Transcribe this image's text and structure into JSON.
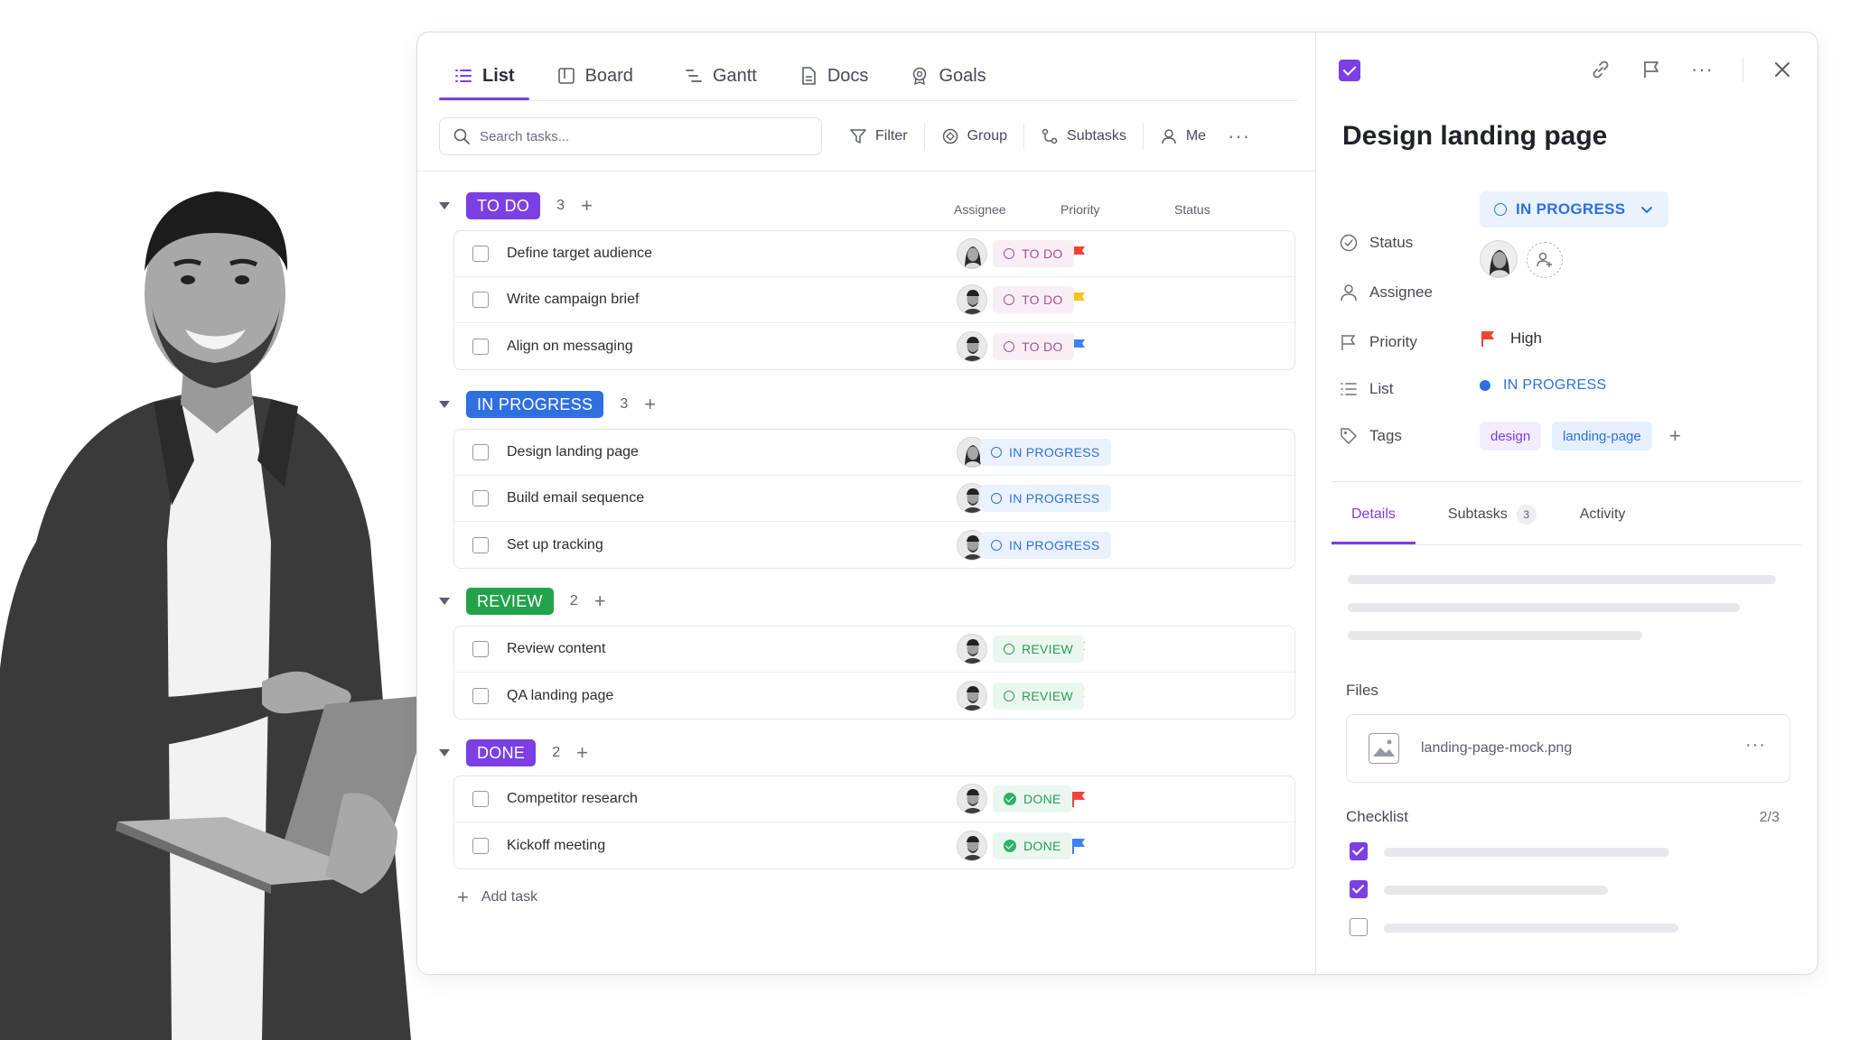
{
  "colors": {
    "accent": "#7b3fe4",
    "todo": "#7b3fe4",
    "in_progress": "#2f6fe0",
    "review": "#22a34a",
    "done": "#7b3fe4",
    "flag_red": "#f04438",
    "flag_yellow": "#f5c518",
    "flag_blue": "#3b82f6"
  },
  "tabs": [
    {
      "label": "List",
      "icon": "list-icon",
      "active": true
    },
    {
      "label": "Board",
      "icon": "board-icon"
    },
    {
      "label": "Gantt",
      "icon": "gantt-icon"
    },
    {
      "label": "Docs",
      "icon": "docs-icon"
    },
    {
      "label": "Goals",
      "icon": "goals-icon"
    }
  ],
  "toolbar": {
    "search_placeholder": "Search tasks...",
    "filter": "Filter",
    "group": "Group",
    "subtasks": "Subtasks",
    "me": "Me"
  },
  "columns": {
    "assignee": "Assignee",
    "priority": "Priority",
    "status": "Status"
  },
  "groups": [
    {
      "label": "TO DO",
      "count": "3",
      "tasks": [
        {
          "name": "Define target audience",
          "priority": "red",
          "status": "TO DO"
        },
        {
          "name": "Write campaign brief",
          "priority": "yellow",
          "status": "TO DO"
        },
        {
          "name": "Align on messaging",
          "priority": "blue",
          "status": "TO DO"
        }
      ]
    },
    {
      "label": "IN PROGRESS",
      "count": "3",
      "tasks": [
        {
          "name": "Design landing page",
          "priority": "red",
          "status": "IN PROGRESS"
        },
        {
          "name": "Build email sequence",
          "priority": "yellow",
          "status": "IN PROGRESS"
        },
        {
          "name": "Set up tracking",
          "priority": "blue",
          "status": "IN PROGRESS"
        }
      ]
    },
    {
      "label": "REVIEW",
      "count": "2",
      "tasks": [
        {
          "name": "Review content",
          "priority": "red",
          "status": "REVIEW"
        },
        {
          "name": "QA landing page",
          "priority": "yellow",
          "status": "REVIEW"
        }
      ]
    },
    {
      "label": "DONE",
      "count": "2",
      "tasks": [
        {
          "name": "Competitor research",
          "priority": "red",
          "status": "DONE"
        },
        {
          "name": "Kickoff meeting",
          "priority": "blue",
          "status": "DONE"
        }
      ]
    }
  ],
  "add_task": "Add task",
  "detail": {
    "title": "Design landing page",
    "props": {
      "status_label": "Status",
      "status_value": "IN PROGRESS",
      "assignee_label": "Assignee",
      "priority_label": "Priority",
      "priority_value": "High",
      "list_label": "List",
      "list_value": "IN PROGRESS",
      "tags_label": "Tags",
      "tags": [
        "design",
        "landing-page"
      ]
    },
    "tabs": [
      {
        "label": "Details",
        "active": true
      },
      {
        "label": "Subtasks",
        "count": "3"
      },
      {
        "label": "Activity"
      }
    ],
    "files_label": "Files",
    "file_name": "landing-page-mock.png",
    "checklist_label": "Checklist",
    "checklist_count": "2/3",
    "checklist_items": [
      true,
      true,
      false
    ]
  }
}
